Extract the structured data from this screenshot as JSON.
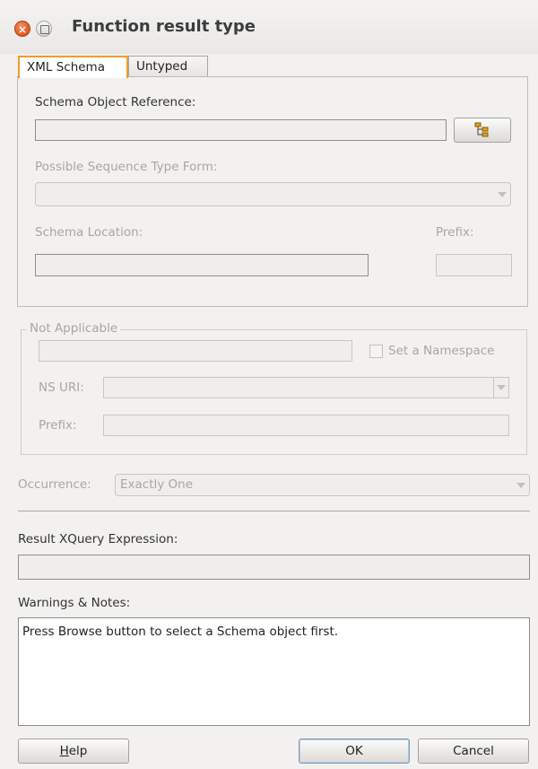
{
  "window": {
    "title": "Function result type",
    "close_glyph": "×"
  },
  "tabs": [
    {
      "label": "XML Schema",
      "active": true
    },
    {
      "label": "Untyped",
      "active": false
    }
  ],
  "schema": {
    "object_reference_label": "Schema Object Reference:",
    "object_reference_value": "",
    "browse_icon": "tree-structure-icon",
    "sequence_type_label": "Possible Sequence Type Form:",
    "sequence_type_value": "",
    "location_label": "Schema Location:",
    "location_value": "",
    "prefix_label": "Prefix:",
    "prefix_value": ""
  },
  "namespace_group": {
    "legend": "Not Applicable",
    "namespace_value": "",
    "set_namespace_label": "Set a Namespace",
    "set_namespace_checked": false,
    "ns_uri_label": "NS URI:",
    "ns_uri_value": "",
    "prefix_label": "Prefix:",
    "prefix_value": ""
  },
  "occurrence": {
    "label": "Occurrence:",
    "value": "Exactly One"
  },
  "result": {
    "label": "Result XQuery Expression:",
    "value": ""
  },
  "notes": {
    "label": "Warnings & Notes:",
    "text": "Press Browse button to select a Schema object first."
  },
  "buttons": {
    "help_mnemonic": "H",
    "help_rest": "elp",
    "ok": "OK",
    "cancel": "Cancel"
  },
  "colors": {
    "accent_tab": "#f19b2c",
    "close_button": "#e2541c",
    "browse_icon": "#c9870c"
  }
}
